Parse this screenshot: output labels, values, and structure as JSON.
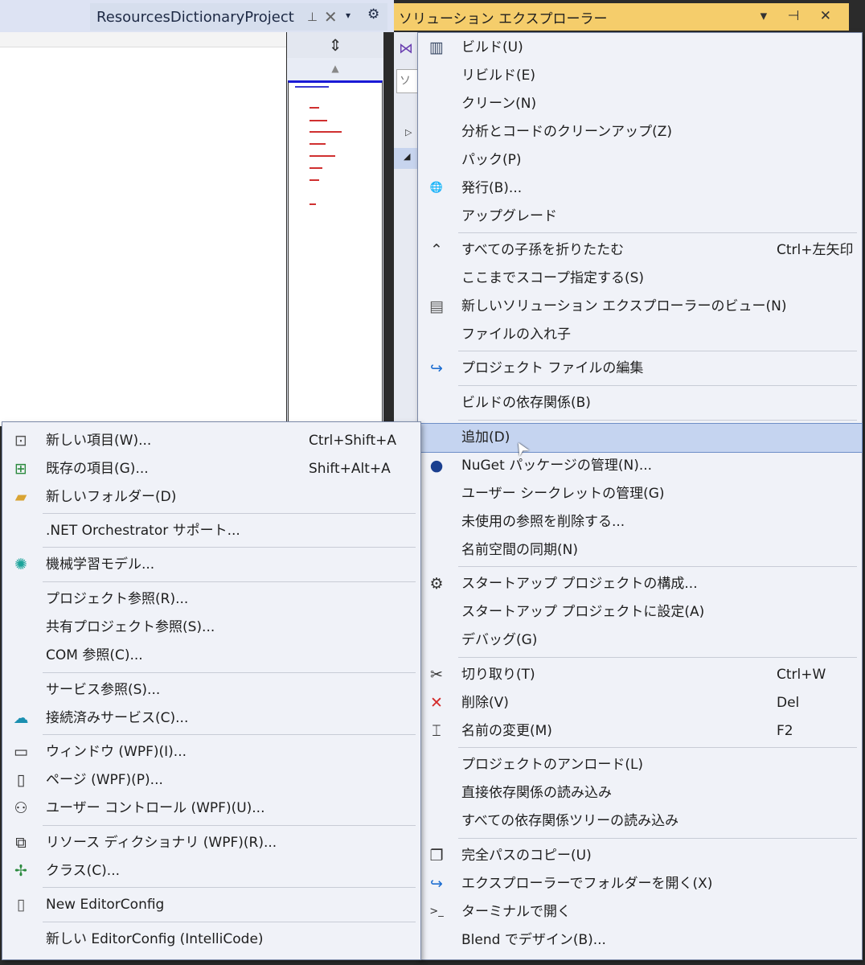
{
  "document_tab": {
    "title": "ResourcesDictionaryProject",
    "pin_icon": "pin-icon",
    "close_icon": "close-icon"
  },
  "tabbar": {
    "dropdown_icon": "▾",
    "gear_icon": "⚙"
  },
  "solution_explorer": {
    "title": "ソリューション エクスプローラー",
    "controls": "▾ ⊣ ✕",
    "search_placeholder": "ソ"
  },
  "context_menu": {
    "items": [
      {
        "label": "ビルド(U)",
        "icon": "build-icon",
        "shortcut": ""
      },
      {
        "label": "リビルド(E)",
        "icon": "",
        "shortcut": ""
      },
      {
        "label": "クリーン(N)",
        "icon": "",
        "shortcut": ""
      },
      {
        "label": "分析とコードのクリーンアップ(Z)",
        "icon": "",
        "shortcut": ""
      },
      {
        "label": "パック(P)",
        "icon": "",
        "shortcut": ""
      },
      {
        "label": "発行(B)...",
        "icon": "publish-globe-icon",
        "shortcut": ""
      },
      {
        "label": "アップグレード",
        "icon": "",
        "shortcut": ""
      },
      {
        "label": "すべての子孫を折りたたむ",
        "icon": "collapse-icon",
        "shortcut": "Ctrl+左矢印"
      },
      {
        "label": "ここまでスコープ指定する(S)",
        "icon": "",
        "shortcut": ""
      },
      {
        "label": "新しいソリューション エクスプローラーのビュー(N)",
        "icon": "new-view-icon",
        "shortcut": ""
      },
      {
        "label": "ファイルの入れ子",
        "icon": "",
        "shortcut": ""
      },
      {
        "label": "プロジェクト ファイルの編集",
        "icon": "edit-project-icon",
        "shortcut": ""
      },
      {
        "label": "ビルドの依存関係(B)",
        "icon": "",
        "shortcut": ""
      },
      {
        "label": "追加(D)",
        "icon": "",
        "shortcut": ""
      },
      {
        "label": "NuGet パッケージの管理(N)...",
        "icon": "nuget-icon",
        "shortcut": ""
      },
      {
        "label": "ユーザー シークレットの管理(G)",
        "icon": "",
        "shortcut": ""
      },
      {
        "label": "未使用の参照を削除する...",
        "icon": "",
        "shortcut": ""
      },
      {
        "label": "名前空間の同期(N)",
        "icon": "",
        "shortcut": ""
      },
      {
        "label": "スタートアップ プロジェクトの構成...",
        "icon": "gear-icon",
        "shortcut": ""
      },
      {
        "label": "スタートアップ プロジェクトに設定(A)",
        "icon": "",
        "shortcut": ""
      },
      {
        "label": "デバッグ(G)",
        "icon": "",
        "shortcut": ""
      },
      {
        "label": "切り取り(T)",
        "icon": "cut-icon",
        "shortcut": "Ctrl+W"
      },
      {
        "label": "削除(V)",
        "icon": "delete-icon",
        "shortcut": "Del"
      },
      {
        "label": "名前の変更(M)",
        "icon": "rename-icon",
        "shortcut": "F2"
      },
      {
        "label": "プロジェクトのアンロード(L)",
        "icon": "",
        "shortcut": ""
      },
      {
        "label": "直接依存関係の読み込み",
        "icon": "",
        "shortcut": ""
      },
      {
        "label": "すべての依存関係ツリーの読み込み",
        "icon": "",
        "shortcut": ""
      },
      {
        "label": "完全パスのコピー(U)",
        "icon": "copy-icon",
        "shortcut": ""
      },
      {
        "label": "エクスプローラーでフォルダーを開く(X)",
        "icon": "open-folder-icon",
        "shortcut": ""
      },
      {
        "label": "ターミナルで開く",
        "icon": "terminal-icon",
        "shortcut": ""
      },
      {
        "label": "Blend でデザイン(B)...",
        "icon": "",
        "shortcut": ""
      }
    ]
  },
  "add_submenu": {
    "items": [
      {
        "label": "新しい項目(W)...",
        "icon": "new-item-icon",
        "shortcut": "Ctrl+Shift+A"
      },
      {
        "label": "既存の項目(G)...",
        "icon": "existing-item-icon",
        "shortcut": "Shift+Alt+A"
      },
      {
        "label": "新しいフォルダー(D)",
        "icon": "new-folder-icon",
        "shortcut": ""
      },
      {
        "label": ".NET Orchestrator サポート...",
        "icon": "",
        "shortcut": ""
      },
      {
        "label": "機械学習モデル...",
        "icon": "ml-model-icon",
        "shortcut": ""
      },
      {
        "label": "プロジェクト参照(R)...",
        "icon": "",
        "shortcut": ""
      },
      {
        "label": "共有プロジェクト参照(S)...",
        "icon": "",
        "shortcut": ""
      },
      {
        "label": "COM 参照(C)...",
        "icon": "",
        "shortcut": ""
      },
      {
        "label": "サービス参照(S)...",
        "icon": "",
        "shortcut": ""
      },
      {
        "label": "接続済みサービス(C)...",
        "icon": "connected-service-icon",
        "shortcut": ""
      },
      {
        "label": "ウィンドウ (WPF)(I)...",
        "icon": "window-icon",
        "shortcut": ""
      },
      {
        "label": "ページ (WPF)(P)...",
        "icon": "page-icon",
        "shortcut": ""
      },
      {
        "label": "ユーザー コントロール (WPF)(U)...",
        "icon": "user-control-icon",
        "shortcut": ""
      },
      {
        "label": "リソース ディクショナリ (WPF)(R)...",
        "icon": "resource-dictionary-icon",
        "shortcut": ""
      },
      {
        "label": "クラス(C)...",
        "icon": "class-icon",
        "shortcut": ""
      },
      {
        "label": "New EditorConfig",
        "icon": "editorconfig-icon",
        "shortcut": ""
      },
      {
        "label": "新しい EditorConfig (IntelliCode)",
        "icon": "",
        "shortcut": ""
      }
    ]
  }
}
